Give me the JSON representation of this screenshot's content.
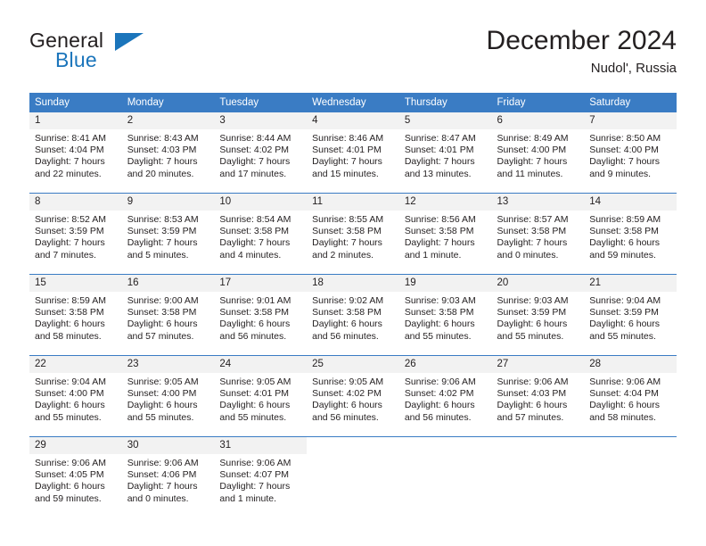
{
  "brand": {
    "name_part1": "General",
    "name_part2": "Blue",
    "triangle_icon": "triangle-icon",
    "accent_color": "#1b75bb"
  },
  "header": {
    "title": "December 2024",
    "location": "Nudol', Russia"
  },
  "theme": {
    "header_bg": "#3a7cc4",
    "header_text": "#ffffff",
    "daynum_bg": "#f2f2f2",
    "cell_bg": "#ffffff",
    "row_divider": "#3a7cc4",
    "text": "#231f20"
  },
  "weekdays": [
    "Sunday",
    "Monday",
    "Tuesday",
    "Wednesday",
    "Thursday",
    "Friday",
    "Saturday"
  ],
  "weeks": [
    [
      {
        "day": "1",
        "sunrise": "Sunrise: 8:41 AM",
        "sunset": "Sunset: 4:04 PM",
        "daylight1": "Daylight: 7 hours",
        "daylight2": "and 22 minutes."
      },
      {
        "day": "2",
        "sunrise": "Sunrise: 8:43 AM",
        "sunset": "Sunset: 4:03 PM",
        "daylight1": "Daylight: 7 hours",
        "daylight2": "and 20 minutes."
      },
      {
        "day": "3",
        "sunrise": "Sunrise: 8:44 AM",
        "sunset": "Sunset: 4:02 PM",
        "daylight1": "Daylight: 7 hours",
        "daylight2": "and 17 minutes."
      },
      {
        "day": "4",
        "sunrise": "Sunrise: 8:46 AM",
        "sunset": "Sunset: 4:01 PM",
        "daylight1": "Daylight: 7 hours",
        "daylight2": "and 15 minutes."
      },
      {
        "day": "5",
        "sunrise": "Sunrise: 8:47 AM",
        "sunset": "Sunset: 4:01 PM",
        "daylight1": "Daylight: 7 hours",
        "daylight2": "and 13 minutes."
      },
      {
        "day": "6",
        "sunrise": "Sunrise: 8:49 AM",
        "sunset": "Sunset: 4:00 PM",
        "daylight1": "Daylight: 7 hours",
        "daylight2": "and 11 minutes."
      },
      {
        "day": "7",
        "sunrise": "Sunrise: 8:50 AM",
        "sunset": "Sunset: 4:00 PM",
        "daylight1": "Daylight: 7 hours",
        "daylight2": "and 9 minutes."
      }
    ],
    [
      {
        "day": "8",
        "sunrise": "Sunrise: 8:52 AM",
        "sunset": "Sunset: 3:59 PM",
        "daylight1": "Daylight: 7 hours",
        "daylight2": "and 7 minutes."
      },
      {
        "day": "9",
        "sunrise": "Sunrise: 8:53 AM",
        "sunset": "Sunset: 3:59 PM",
        "daylight1": "Daylight: 7 hours",
        "daylight2": "and 5 minutes."
      },
      {
        "day": "10",
        "sunrise": "Sunrise: 8:54 AM",
        "sunset": "Sunset: 3:58 PM",
        "daylight1": "Daylight: 7 hours",
        "daylight2": "and 4 minutes."
      },
      {
        "day": "11",
        "sunrise": "Sunrise: 8:55 AM",
        "sunset": "Sunset: 3:58 PM",
        "daylight1": "Daylight: 7 hours",
        "daylight2": "and 2 minutes."
      },
      {
        "day": "12",
        "sunrise": "Sunrise: 8:56 AM",
        "sunset": "Sunset: 3:58 PM",
        "daylight1": "Daylight: 7 hours",
        "daylight2": "and 1 minute."
      },
      {
        "day": "13",
        "sunrise": "Sunrise: 8:57 AM",
        "sunset": "Sunset: 3:58 PM",
        "daylight1": "Daylight: 7 hours",
        "daylight2": "and 0 minutes."
      },
      {
        "day": "14",
        "sunrise": "Sunrise: 8:59 AM",
        "sunset": "Sunset: 3:58 PM",
        "daylight1": "Daylight: 6 hours",
        "daylight2": "and 59 minutes."
      }
    ],
    [
      {
        "day": "15",
        "sunrise": "Sunrise: 8:59 AM",
        "sunset": "Sunset: 3:58 PM",
        "daylight1": "Daylight: 6 hours",
        "daylight2": "and 58 minutes."
      },
      {
        "day": "16",
        "sunrise": "Sunrise: 9:00 AM",
        "sunset": "Sunset: 3:58 PM",
        "daylight1": "Daylight: 6 hours",
        "daylight2": "and 57 minutes."
      },
      {
        "day": "17",
        "sunrise": "Sunrise: 9:01 AM",
        "sunset": "Sunset: 3:58 PM",
        "daylight1": "Daylight: 6 hours",
        "daylight2": "and 56 minutes."
      },
      {
        "day": "18",
        "sunrise": "Sunrise: 9:02 AM",
        "sunset": "Sunset: 3:58 PM",
        "daylight1": "Daylight: 6 hours",
        "daylight2": "and 56 minutes."
      },
      {
        "day": "19",
        "sunrise": "Sunrise: 9:03 AM",
        "sunset": "Sunset: 3:58 PM",
        "daylight1": "Daylight: 6 hours",
        "daylight2": "and 55 minutes."
      },
      {
        "day": "20",
        "sunrise": "Sunrise: 9:03 AM",
        "sunset": "Sunset: 3:59 PM",
        "daylight1": "Daylight: 6 hours",
        "daylight2": "and 55 minutes."
      },
      {
        "day": "21",
        "sunrise": "Sunrise: 9:04 AM",
        "sunset": "Sunset: 3:59 PM",
        "daylight1": "Daylight: 6 hours",
        "daylight2": "and 55 minutes."
      }
    ],
    [
      {
        "day": "22",
        "sunrise": "Sunrise: 9:04 AM",
        "sunset": "Sunset: 4:00 PM",
        "daylight1": "Daylight: 6 hours",
        "daylight2": "and 55 minutes."
      },
      {
        "day": "23",
        "sunrise": "Sunrise: 9:05 AM",
        "sunset": "Sunset: 4:00 PM",
        "daylight1": "Daylight: 6 hours",
        "daylight2": "and 55 minutes."
      },
      {
        "day": "24",
        "sunrise": "Sunrise: 9:05 AM",
        "sunset": "Sunset: 4:01 PM",
        "daylight1": "Daylight: 6 hours",
        "daylight2": "and 55 minutes."
      },
      {
        "day": "25",
        "sunrise": "Sunrise: 9:05 AM",
        "sunset": "Sunset: 4:02 PM",
        "daylight1": "Daylight: 6 hours",
        "daylight2": "and 56 minutes."
      },
      {
        "day": "26",
        "sunrise": "Sunrise: 9:06 AM",
        "sunset": "Sunset: 4:02 PM",
        "daylight1": "Daylight: 6 hours",
        "daylight2": "and 56 minutes."
      },
      {
        "day": "27",
        "sunrise": "Sunrise: 9:06 AM",
        "sunset": "Sunset: 4:03 PM",
        "daylight1": "Daylight: 6 hours",
        "daylight2": "and 57 minutes."
      },
      {
        "day": "28",
        "sunrise": "Sunrise: 9:06 AM",
        "sunset": "Sunset: 4:04 PM",
        "daylight1": "Daylight: 6 hours",
        "daylight2": "and 58 minutes."
      }
    ],
    [
      {
        "day": "29",
        "sunrise": "Sunrise: 9:06 AM",
        "sunset": "Sunset: 4:05 PM",
        "daylight1": "Daylight: 6 hours",
        "daylight2": "and 59 minutes."
      },
      {
        "day": "30",
        "sunrise": "Sunrise: 9:06 AM",
        "sunset": "Sunset: 4:06 PM",
        "daylight1": "Daylight: 7 hours",
        "daylight2": "and 0 minutes."
      },
      {
        "day": "31",
        "sunrise": "Sunrise: 9:06 AM",
        "sunset": "Sunset: 4:07 PM",
        "daylight1": "Daylight: 7 hours",
        "daylight2": "and 1 minute."
      },
      {
        "day": "",
        "sunrise": "",
        "sunset": "",
        "daylight1": "",
        "daylight2": ""
      },
      {
        "day": "",
        "sunrise": "",
        "sunset": "",
        "daylight1": "",
        "daylight2": ""
      },
      {
        "day": "",
        "sunrise": "",
        "sunset": "",
        "daylight1": "",
        "daylight2": ""
      },
      {
        "day": "",
        "sunrise": "",
        "sunset": "",
        "daylight1": "",
        "daylight2": ""
      }
    ]
  ]
}
